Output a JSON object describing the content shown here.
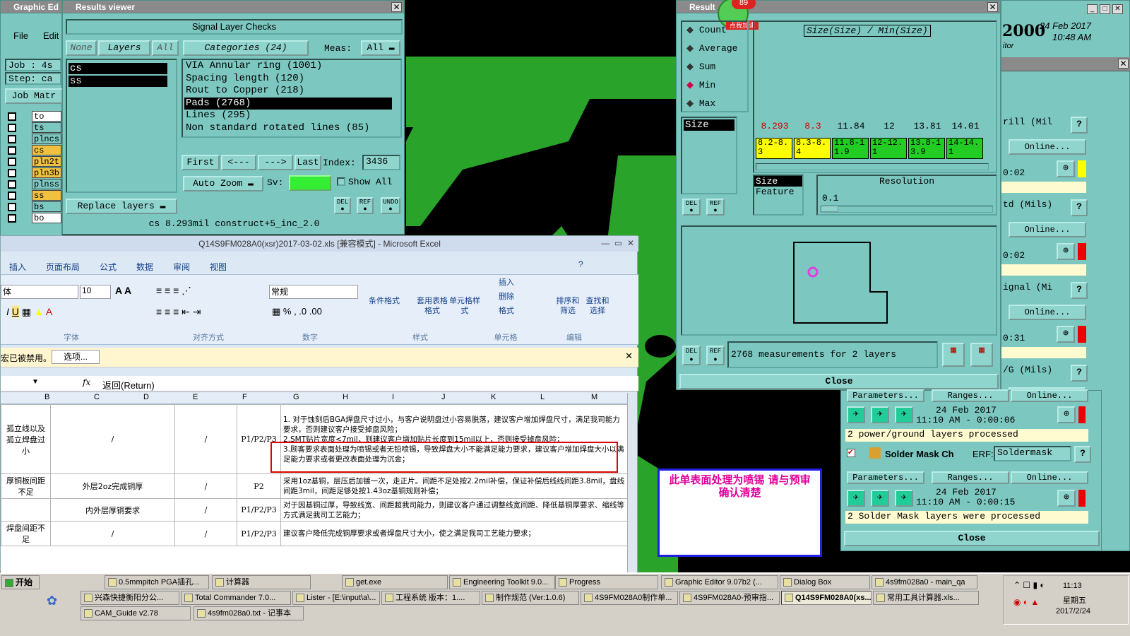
{
  "ge": {
    "title": "Graphic Ed",
    "menu_file": "File",
    "menu_edit": "Edit",
    "job": "Job : 4s",
    "step": "Step: ca",
    "job_matrix": "Job Matr",
    "layers": [
      "to",
      "ts",
      "plncs",
      "cs",
      "pln2t",
      "pln3b",
      "plnss",
      "ss",
      "bs",
      "bo"
    ]
  },
  "rv": {
    "title": "Results viewer",
    "heading": "Signal Layer Checks",
    "none": "None",
    "layers": "Layers",
    "all": "All",
    "categories_label": "Categories (24)",
    "meas_label": "Meas:",
    "meas_value": "All",
    "layer_list": [
      "cs",
      "ss"
    ],
    "categories": [
      "VIA Annular ring (1001)",
      "Spacing length (120)",
      "Rout to Copper (218)",
      "Pads (2768)",
      "Lines (295)",
      "Non standard rotated lines (85)"
    ],
    "first": "First",
    "prev": "<---",
    "next": "--->",
    "last": "Last",
    "index_label": "Index:",
    "index_value": "3436",
    "auto_zoom": "Auto Zoom",
    "sv_label": "Sv:",
    "show_all": "Show All",
    "replace_layers": "Replace layers",
    "del": "DEL",
    "ref": "REF",
    "undo": "UNDO",
    "status": "cs 8.293mil  construct+5_inc_2.0"
  },
  "rw": {
    "title": "Result",
    "stats": [
      "Count",
      "Average",
      "Sum",
      "Min",
      "Max"
    ],
    "selected_stat": "Min",
    "chart_title": "Size(Size) / Min(Size)",
    "hist_values": [
      "8.293",
      "8.3",
      "11.84",
      "12",
      "13.81",
      "14.01"
    ],
    "hist_bins": [
      "8.2-8.3",
      "8.3-8.4",
      "11.8-11.9",
      "12-12.1",
      "13.8-13.9",
      "14-14.1"
    ],
    "size_list": [
      "Size"
    ],
    "size2": "Size",
    "feature": "Feature",
    "resolution_label": "Resolution",
    "resolution_value": "0.1",
    "measurements": "2768 measurements for 2 layers",
    "close": "Close",
    "badge": "89",
    "badge_text": "点我加速"
  },
  "ap": {
    "year": "2000",
    "date1": "24 Feb 2017",
    "time1": "10:48 AM",
    "itor": "itor",
    "rows": [
      {
        "label": "rill (Mil",
        "online": "Online...",
        "t": "0:02"
      },
      {
        "label": "td (Mils)",
        "online": "Online...",
        "t": "0:02"
      },
      {
        "label": "ignal (Mi",
        "online": "Online...",
        "t": "0:31"
      },
      {
        "label": "/G (Mils)",
        "online": "Online...",
        "t": ""
      }
    ],
    "params": "Parameters...",
    "ranges": "Ranges...",
    "online": "Online...",
    "ts1": "24 Feb 2017",
    "ts1b": "11:10 AM - 0:00:06",
    "msg1": "2 power/ground layers processed",
    "solder": "Solder Mask Ch",
    "erf": "ERF:",
    "soldermask": "Soldermask",
    "ts2": "24 Feb 2017",
    "ts2b": "11:10 AM - 0:00:15",
    "msg2": "2 Solder Mask layers were processed",
    "close": "Close",
    "q": "?"
  },
  "xl": {
    "title": "Q14S9FM028A0(xsr)2017-03-02.xls  [兼容模式] - Microsoft Excel",
    "tabs": [
      "插入",
      "页面布局",
      "公式",
      "数据",
      "审阅",
      "视图"
    ],
    "font": "体",
    "size": "10",
    "number_format": "常规",
    "groups": [
      "字体",
      "对齐方式",
      "数字",
      "样式",
      "单元格",
      "编辑"
    ],
    "btns": [
      "条件格式",
      "套用表格格式",
      "单元格样式",
      "插入",
      "删除",
      "格式",
      "排序和筛选",
      "查找和选择"
    ],
    "warn": "宏已被禁用。",
    "options": "选项...",
    "fx": "fx",
    "formula": "返回(Return)",
    "cols": [
      "B",
      "C",
      "D",
      "E",
      "F",
      "G",
      "H",
      "I",
      "J",
      "K",
      "L",
      "M"
    ],
    "rows": [
      {
        "b": "孤立线以及孤立焊盘过小",
        "c": "/",
        "e": "/",
        "f": "P1/P2/P3",
        "g": "1. 对于蚀刻后BGA焊盘尺寸过小，与客户说明盘过小容易脱落，建议客户增加焊盘尺寸，满足我司能力要求，否则建议客户接受掉盘风险；\n2.SMT贴片宽度<7mil，则建议客户增加贴片长度到15mil以上，否则接受掉盘风险；\n3.顾客要求表面处理为喷锡或者无铅喷锡，导致焊盘大小不能满足能力要求，建议客户增加焊盘大小以满足能力要求或者更改表面处理为沉金；"
      },
      {
        "b": "厚铜板间距不足",
        "c": "外层2oz完成铜厚",
        "e": "/",
        "f": "P2",
        "g": "采用1oz基铜，层压后加镀一次，走正片。间距不足处按2.2mil补偿，保证补偿后线线间距3.8mil，盘线间距3mil，间距足够处按1.43oz基铜规则补偿；"
      },
      {
        "b": "",
        "c": "内外层厚铜要求",
        "e": "/",
        "f": "P1/P2/P3",
        "g": "对于因基铜过厚，导致线宽、间距超我司能力，则建议客户通过调整线宽间距、降低基铜厚要求、缩线等方式满足我司工艺能力；"
      },
      {
        "b": "焊盘间距不足",
        "c": "/",
        "e": "/",
        "f": "P1/P2/P3",
        "g": "建议客户降低完成铜厚要求或者焊盘尺寸大小，使之满足我司工艺能力要求；"
      }
    ]
  },
  "note": {
    "text": "此单表面处理为喷锡    请与预审确认清楚"
  },
  "tb": {
    "start": "开始",
    "row1": [
      "0.5mmpitch PGA插孔...",
      "计算器",
      "get.exe",
      "Engineering Toolkit 9.0...",
      "Progress",
      "Graphic Editor 9.07b2 (...",
      "Dialog Box",
      "4s9fm028a0 - main_qa"
    ],
    "row2": [
      "兴森快捷衡阳分公...",
      "Total Commander 7.0...",
      "Lister - [E:\\input\\a\\...",
      "工程系统  版本：1....",
      "制作规范 (Ver:1.0.6)",
      "4S9FM028A0制作单...",
      "4S9FM028A0-预审指...",
      "Q14S9FM028A0(xs...",
      "常用工具计算器.xls..."
    ],
    "row3": [
      "CAM_Guide v2.78",
      "4s9fm028a0.txt - 记事本"
    ],
    "clock": "11:13",
    "weekday": "星期五",
    "date": "2017/2/24"
  }
}
